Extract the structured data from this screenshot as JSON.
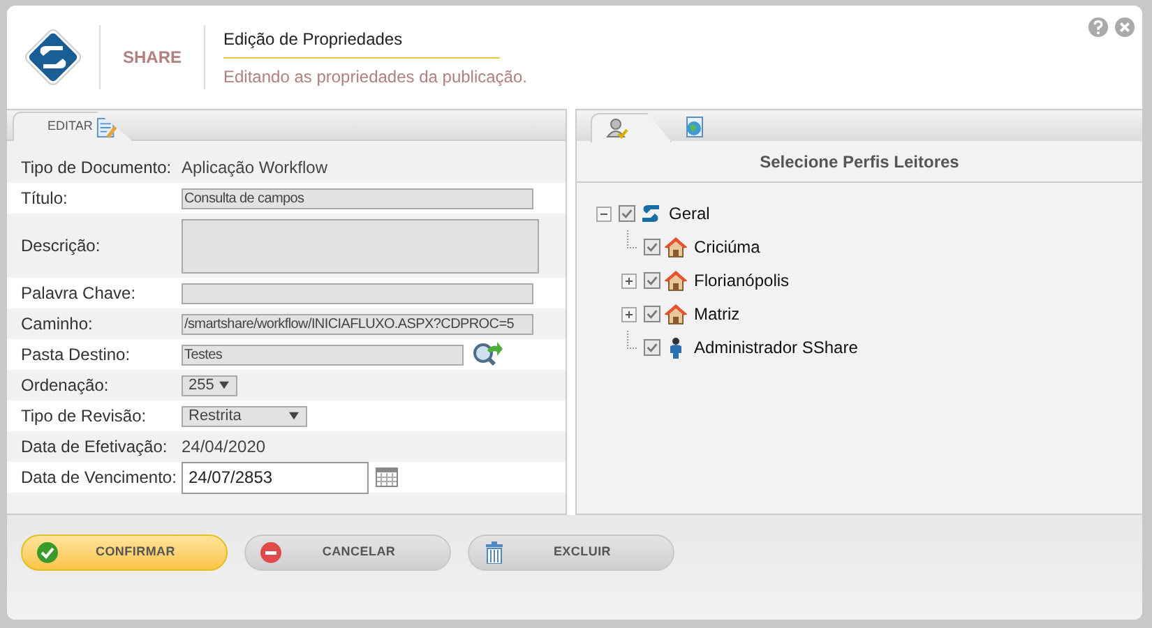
{
  "header": {
    "brand": "SHARE",
    "title": "Edição de Propriedades",
    "subtitle": "Editando as propriedades da publicação."
  },
  "left_panel": {
    "tabs": [
      {
        "label": "EDITAR",
        "selected": true
      }
    ],
    "fields": [
      {
        "kind": "readonly",
        "label": "Tipo de Documento:",
        "value": "Aplicação Workflow"
      },
      {
        "kind": "input",
        "label": "Título:",
        "value": "Consulta de campos"
      },
      {
        "kind": "textarea",
        "label": "Descrição:"
      },
      {
        "kind": "input",
        "label": "Palavra Chave:"
      },
      {
        "kind": "input",
        "label": "Caminho:",
        "value": "/smartshare/workflow/INICIAFLUXO.ASPX?CDPROC=5"
      },
      {
        "kind": "folder",
        "label": "Pasta Destino:",
        "value": "Testes"
      },
      {
        "kind": "select_small",
        "label": "Ordenação:",
        "value": "255"
      },
      {
        "kind": "select",
        "label": "Tipo de Revisão:",
        "value": "Restrita"
      },
      {
        "kind": "readonly",
        "label": "Data de Efetivação:",
        "value": "24/04/2020"
      },
      {
        "kind": "date",
        "label": "Data de Vencimento:",
        "value": "24/07/2853"
      }
    ]
  },
  "right_panel": {
    "tabs": [
      {
        "kind": "profiles",
        "selected": true
      },
      {
        "kind": "web",
        "selected": false
      }
    ],
    "heading": "Selecione Perfis Leitores",
    "tree": [
      {
        "kind": "company",
        "label": "Geral",
        "checked": true,
        "expanded": true,
        "children": [
          {
            "kind": "unit",
            "label": "Criciúma",
            "checked": true
          },
          {
            "kind": "unit",
            "label": "Florianópolis",
            "checked": true,
            "expanded": false
          },
          {
            "kind": "unit",
            "label": "Matriz",
            "checked": true,
            "expanded": false
          },
          {
            "kind": "user",
            "label": "Administrador SShare",
            "checked": true
          }
        ]
      }
    ]
  },
  "buttons": [
    {
      "kind": "confirm",
      "label": "CONFIRMAR"
    },
    {
      "kind": "cancel",
      "label": "CANCELAR"
    },
    {
      "kind": "delete",
      "label": "EXCLUIR"
    }
  ]
}
